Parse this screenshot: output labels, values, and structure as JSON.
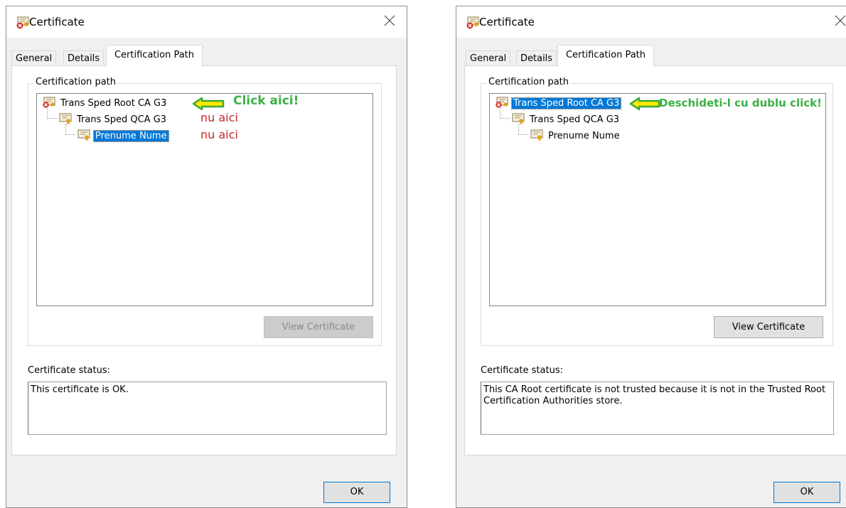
{
  "colors": {
    "accent": "#0078d7",
    "annotation_green": "#39b043",
    "annotation_red": "#c62828"
  },
  "left_dialog": {
    "title": "Certificate",
    "tabs": [
      "General",
      "Details",
      "Certification Path"
    ],
    "active_tab": "Certification Path",
    "group_label": "Certification path",
    "tree": [
      {
        "label": "Trans Sped Root CA G3",
        "icon": "certificate-error-icon",
        "selected": false
      },
      {
        "label": "Trans Sped QCA G3",
        "icon": "certificate-icon",
        "selected": false
      },
      {
        "label": "Prenume Nume",
        "icon": "certificate-icon",
        "selected": true
      }
    ],
    "annotations": {
      "click_here": "Click aici!",
      "not_here_1": "nu aici",
      "not_here_2": "nu aici"
    },
    "view_button": "View Certificate",
    "view_button_enabled": false,
    "status_label": "Certificate status:",
    "status_text": "This certificate is OK.",
    "ok_button": "OK"
  },
  "right_dialog": {
    "title": "Certificate",
    "tabs": [
      "General",
      "Details",
      "Certification Path"
    ],
    "active_tab": "Certification Path",
    "group_label": "Certification path",
    "tree": [
      {
        "label": "Trans Sped Root CA G3",
        "icon": "certificate-error-icon",
        "selected": true
      },
      {
        "label": "Trans Sped QCA G3",
        "icon": "certificate-icon",
        "selected": false
      },
      {
        "label": "Prenume Nume",
        "icon": "certificate-icon",
        "selected": false
      }
    ],
    "annotations": {
      "double_click": "Deschideti-l cu dublu click!"
    },
    "view_button": "View Certificate",
    "view_button_enabled": true,
    "status_label": "Certificate status:",
    "status_text": "This CA Root certificate is not trusted because it is not in the Trusted Root Certification Authorities store.",
    "ok_button": "OK"
  }
}
